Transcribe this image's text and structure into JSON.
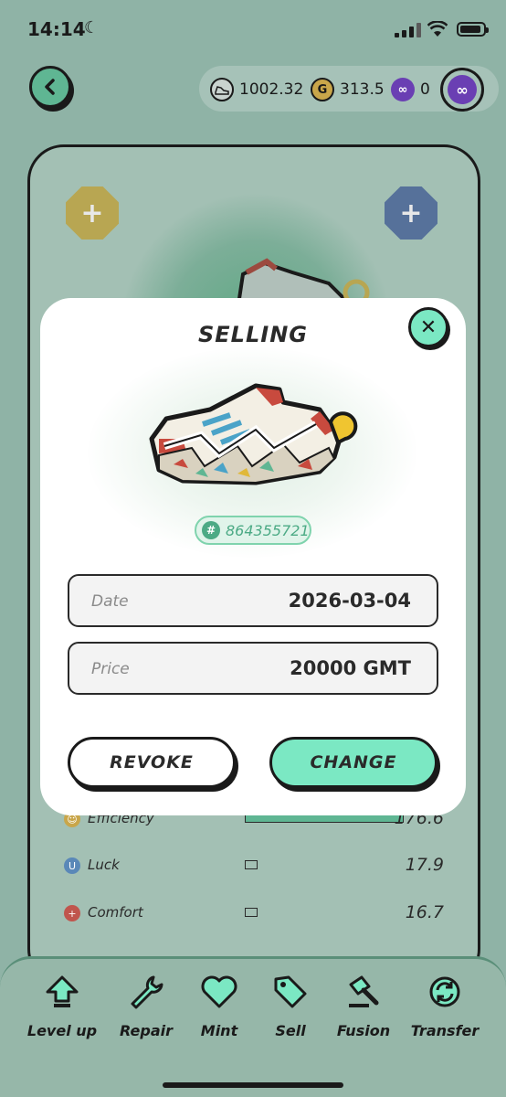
{
  "status_bar": {
    "time": "14:14"
  },
  "balances": [
    {
      "icon": "sneaker-token-icon",
      "value": "1002.32"
    },
    {
      "icon": "gmt-coin-icon",
      "value": "313.5"
    },
    {
      "icon": "polygon-icon",
      "value": "0"
    }
  ],
  "attributes": [
    {
      "name": "Efficiency",
      "value": "176.6"
    },
    {
      "name": "Luck",
      "value": "17.9"
    },
    {
      "name": "Comfort",
      "value": "16.7"
    }
  ],
  "bottom_nav": [
    {
      "label": "Level up",
      "icon": "level-up-arrow-icon"
    },
    {
      "label": "Repair",
      "icon": "wrench-icon"
    },
    {
      "label": "Mint",
      "icon": "heart-icon"
    },
    {
      "label": "Sell",
      "icon": "price-tag-icon"
    },
    {
      "label": "Fusion",
      "icon": "hammer-icon"
    },
    {
      "label": "Transfer",
      "icon": "transfer-cycle-icon"
    }
  ],
  "modal": {
    "title": "SELLING",
    "sneaker_id": "864355721",
    "fields": [
      {
        "label": "Date",
        "value": "2026-03-04"
      },
      {
        "label": "Price",
        "value": "20000 GMT"
      }
    ],
    "revoke_label": "REVOKE",
    "change_label": "CHANGE"
  },
  "colors": {
    "accent": "#7be8c3",
    "overlay_bg": "#8fb3a6",
    "badge_green": "#4caa85"
  }
}
